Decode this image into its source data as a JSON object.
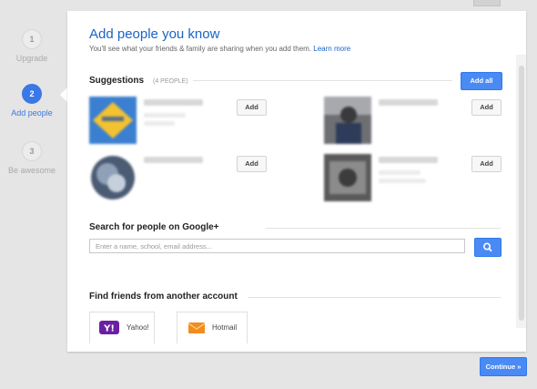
{
  "steps": [
    {
      "num": "1",
      "label": "Upgrade"
    },
    {
      "num": "2",
      "label": "Add people"
    },
    {
      "num": "3",
      "label": "Be awesome"
    }
  ],
  "header": {
    "title": "Add people you know",
    "subtitle": "You'll see what your friends & family are sharing when you add them.",
    "learn_more": "Learn more"
  },
  "suggestions": {
    "heading": "Suggestions",
    "count": "(4 PEOPLE)",
    "add_all": "Add all",
    "add_label": "Add"
  },
  "search": {
    "heading": "Search for people on Google+",
    "placeholder": "Enter a name, school, email address..."
  },
  "accounts": {
    "heading": "Find friends from another account",
    "yahoo": "Yahoo!",
    "hotmail": "Hotmail"
  },
  "footer": {
    "continue": "Continue »"
  }
}
